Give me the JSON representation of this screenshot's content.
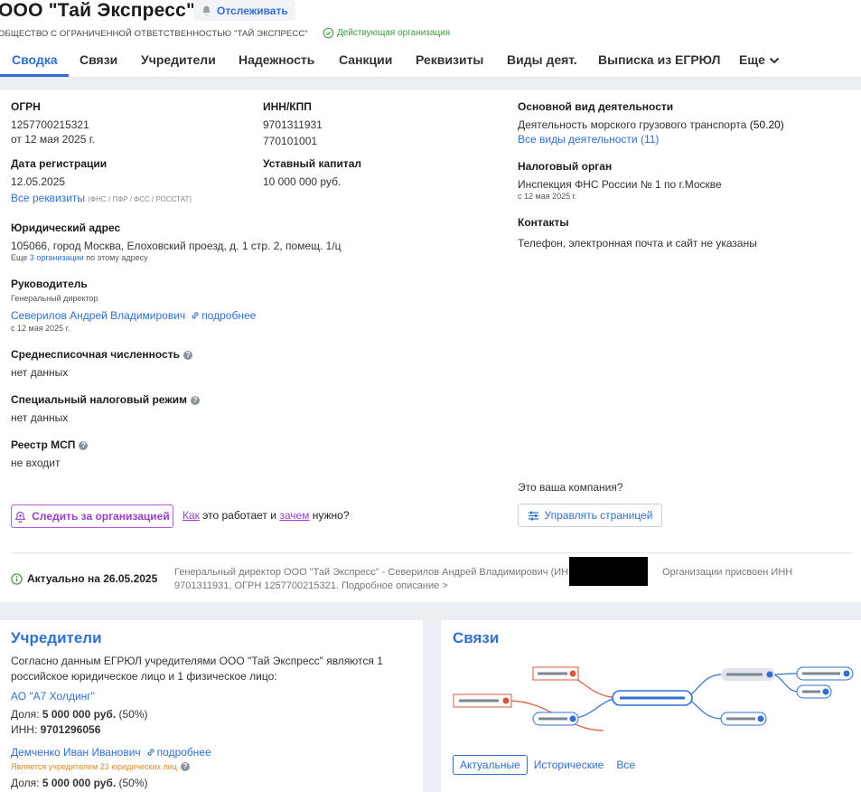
{
  "header": {
    "title": "ООО \"Тай Экспресс\"",
    "track_label": "Отслеживать",
    "full_name": "ОБЩЕСТВО С ОГРАНИЧЕННОЙ ОТВЕТСТВЕННОСТЬЮ \"ТАЙ ЭКСПРЕСС\"",
    "status": "Действующая организация"
  },
  "tabs": [
    "Сводка",
    "Связи",
    "Учредители",
    "Надежность",
    "Санкции",
    "Реквизиты",
    "Виды деят.",
    "Выписка из ЕГРЮЛ",
    "Еще"
  ],
  "summary": {
    "ogrn_label": "ОГРН",
    "ogrn_value": "1257700215321",
    "ogrn_date": "от 12 мая 2025 г.",
    "inn_label": "ИНН/КПП",
    "inn_value": "9701311931",
    "kpp_value": "770101001",
    "reg_label": "Дата регистрации",
    "reg_value": "12.05.2025",
    "all_details": "Все реквизиты",
    "all_details_note": "(ФНС / ПФР / ФСС / РОССТАТ)",
    "capital_label": "Уставный капитал",
    "capital_value": "10 000 000 руб.",
    "address_label": "Юридический адрес",
    "address_value": "105066, город Москва, Елоховский проезд, д. 1 стр. 2, помещ. 1/ц",
    "address_more_pre": "Еще",
    "address_more_link": "3 организации",
    "address_more_post": "по этому адресу",
    "head_label": "Руководитель",
    "head_role": "Генеральный директор",
    "head_name": "Северилов Андрей Владимирович",
    "head_more": "подробнее",
    "head_since": "с 12 мая 2025 г.",
    "staff_label": "Среднесписочная численность",
    "staff_value": "нет данных",
    "tax_regime_label": "Специальный налоговый режим",
    "tax_regime_value": "нет данных",
    "msp_label": "Реестр МСП",
    "msp_value": "не входит",
    "activity_label": "Основной вид деятельности",
    "activity_value": "Деятельность морского грузового транспорта",
    "activity_code": "(50.20)",
    "activity_all": "Все виды деятельности (11)",
    "tax_label": "Налоговый орган",
    "tax_value": "Инспекция ФНС России № 1 по г.Москве",
    "tax_since": "с 12 мая 2025 г.",
    "contacts_label": "Контакты",
    "contacts_value": "Телефон, электронная почта и сайт не указаны",
    "your_company": "Это ваша компания?",
    "manage_btn": "Управлять страницей",
    "follow_btn": "Следить за организацией",
    "how_a": "Как",
    "how_mid": "это работает и",
    "how_b": "зачем",
    "how_end": "нужно?",
    "actual": "Актуально на 26.05.2025",
    "description_pre": "Генеральный директор ООО \"Тай Экспресс\" - Северилов Андрей Владимирович (ИНН",
    "description_post": "Организации присвоен ИНН 9701311931, ОГРН 1257700215321. Подробное описание >"
  },
  "founders": {
    "title": "Учредители",
    "text": "Согласно данным ЕГРЮЛ учредителями ООО \"Тай Экспресс\" являются 1 российское юридическое лицо и 1 физическое лицо:",
    "f1_name": "АО \"А7 Холдинг\"",
    "share_label": "Доля:",
    "f1_share": "5 000 000 руб.",
    "f1_pct": "(50%)",
    "inn_label": "ИНН:",
    "f1_inn": "9701296056",
    "f2_name": "Демченко Иван Иванович",
    "f2_more": "подробнее",
    "f2_note": "Является учредителем 23 юридических лиц",
    "f2_share": "5 000 000 руб.",
    "f2_pct": "(50%)"
  },
  "links": {
    "title": "Связи",
    "tabs": [
      "Актуальные",
      "Исторические",
      "Все"
    ]
  },
  "colors": {
    "accent": "#2f6fd6",
    "green": "#3d9a3d",
    "purple": "#9b3dd0",
    "orange": "#e08a1e",
    "red": "#e0543a"
  }
}
